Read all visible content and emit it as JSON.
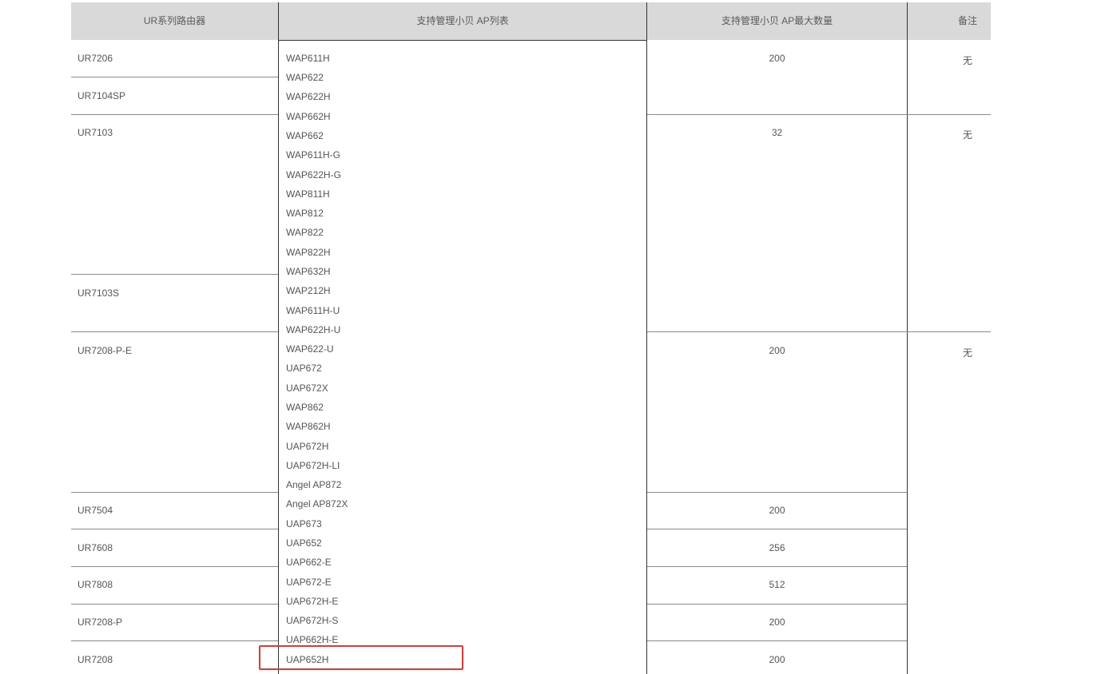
{
  "table": {
    "headers": [
      "UR系列路由器",
      "支持管理小贝 AP列表",
      "支持管理小贝 AP最大数量",
      "备注"
    ],
    "routers": [
      "UR7206",
      "UR7104SP",
      "UR7103",
      "UR7103S",
      "UR7208-P-E",
      "UR7504",
      "UR7608",
      "UR7808",
      "UR7208-P",
      "UR7208"
    ],
    "ap_list": [
      "WAP611H",
      "WAP622",
      "WAP622H",
      "WAP662H",
      "WAP662",
      "WAP611H-G",
      "WAP622H-G",
      "WAP811H",
      "WAP812",
      "WAP822",
      "WAP822H",
      "WAP632H",
      "WAP212H",
      "WAP611H-U",
      "WAP622H-U",
      "WAP622-U",
      "UAP672",
      "UAP672X",
      "WAP862",
      "WAP862H",
      "UAP672H",
      "UAP672H-LI",
      "Angel AP872",
      "Angel AP872X",
      "UAP673",
      "UAP652",
      "UAP662-E",
      "UAP672-E",
      "UAP672H-E",
      "UAP672H-S",
      "UAP662H-E",
      "UAP652H"
    ],
    "max_counts": [
      "200",
      "32",
      "200",
      "200",
      "256",
      "512",
      "200",
      "200"
    ],
    "notes": [
      "无",
      "无",
      "无"
    ],
    "highlighted_ap": "UAP652H",
    "highlight_color": "#e53935"
  }
}
